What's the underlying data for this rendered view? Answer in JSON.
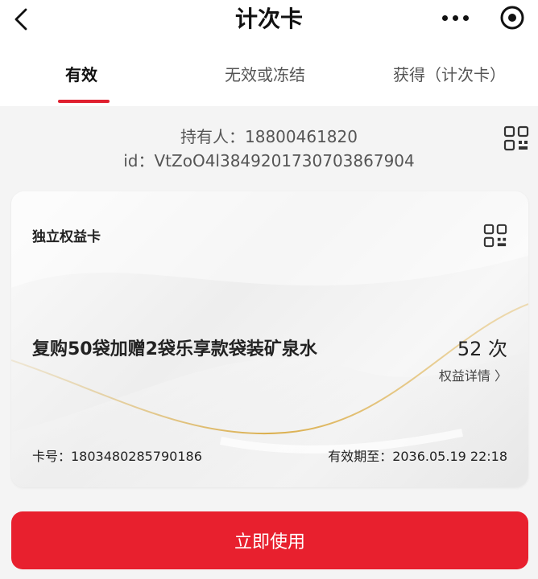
{
  "header": {
    "title": "计次卡"
  },
  "tabs": [
    {
      "label": "有效"
    },
    {
      "label": "无效或冻结"
    },
    {
      "label": "获得（计次卡）"
    }
  ],
  "holder": {
    "line1": "持有人：18800461820",
    "line2": "id：VtZoO4l3849201730703867904"
  },
  "card": {
    "type": "独立权益卡",
    "name": "复购50袋加赠2袋乐享款袋装矿泉水",
    "count": "52 次",
    "detail_link": "权益详情 〉",
    "card_number": "卡号：1803480285790186",
    "expire": "有效期至：2036.05.19 22:18"
  },
  "actions": {
    "use_label": "立即使用"
  },
  "colors": {
    "accent": "#e8202e"
  }
}
